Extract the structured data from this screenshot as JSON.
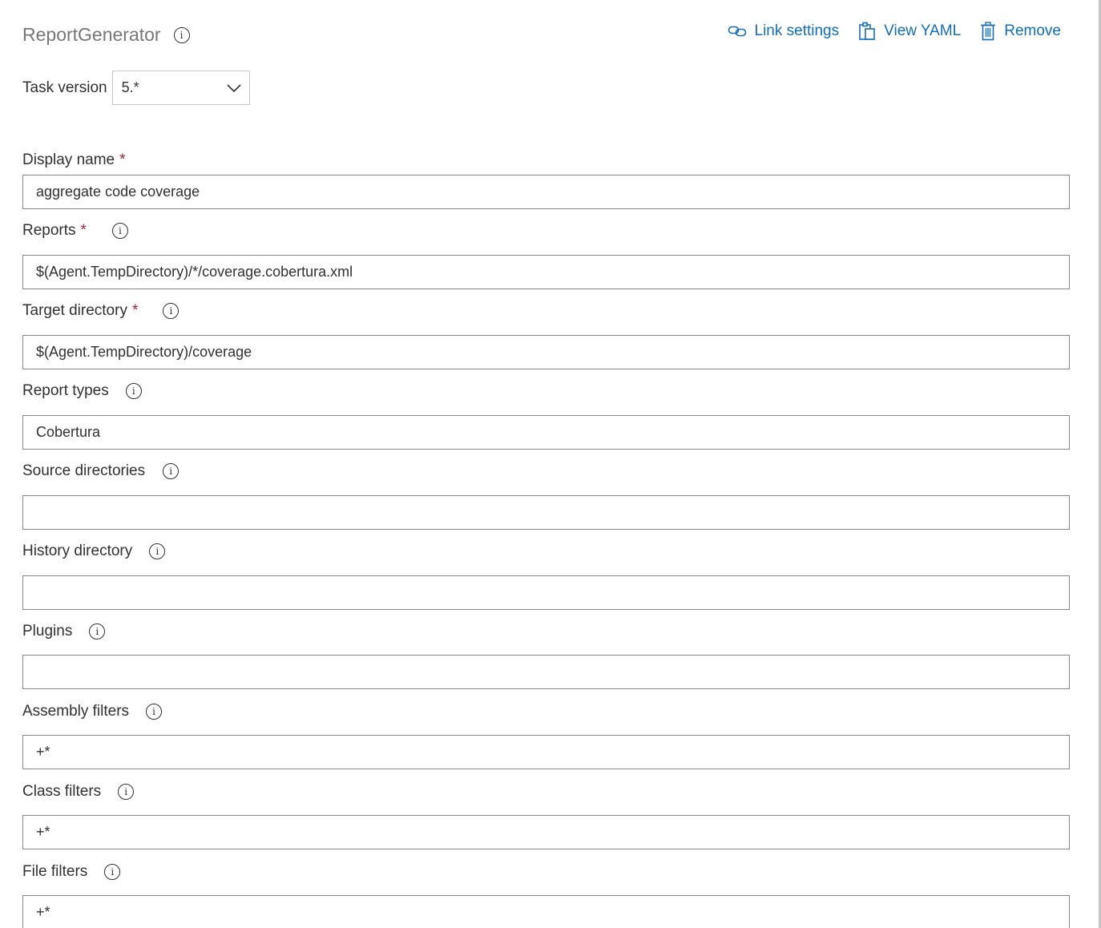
{
  "task": {
    "title": "ReportGenerator",
    "info_icon": "info-icon"
  },
  "toolbar": {
    "link_settings_label": "Link settings",
    "link_icon": "link-icon",
    "view_yaml_label": "View YAML",
    "clipboard_icon": "clipboard-icon",
    "remove_label": "Remove",
    "trash_icon": "trash-icon",
    "accent_color": "#106ebe"
  },
  "task_version": {
    "label": "Task version",
    "selected": "5.*",
    "chevron_icon": "chevron-down-icon"
  },
  "fields": {
    "display_name": {
      "label": "Display name",
      "required": "*",
      "value": "aggregate code coverage"
    },
    "reports": {
      "label": "Reports",
      "required": "*",
      "value": "$(Agent.TempDirectory)/*/coverage.cobertura.xml"
    },
    "target_directory": {
      "label": "Target directory",
      "required": "*",
      "value": "$(Agent.TempDirectory)/coverage"
    },
    "report_types": {
      "label": "Report types",
      "value": "Cobertura"
    },
    "source_directories": {
      "label": "Source directories",
      "value": ""
    },
    "history_directory": {
      "label": "History directory",
      "value": ""
    },
    "plugins": {
      "label": "Plugins",
      "value": ""
    },
    "assembly_filters": {
      "label": "Assembly filters",
      "value": "+*"
    },
    "class_filters": {
      "label": "Class filters",
      "value": "+*"
    },
    "file_filters": {
      "label": "File filters",
      "value": "+*"
    }
  },
  "colors": {
    "required_asterisk": "#a4262c",
    "input_border": "#8a8886",
    "title_gray": "#797775"
  }
}
